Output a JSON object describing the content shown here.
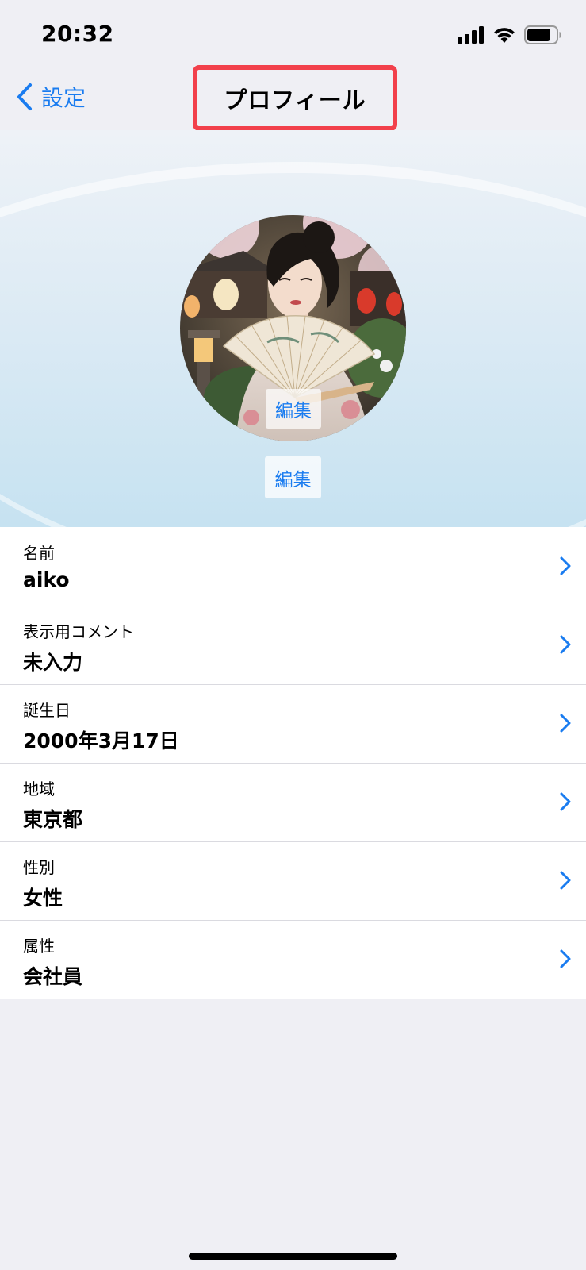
{
  "status_bar": {
    "time": "20:32"
  },
  "nav": {
    "back_label": "設定",
    "title": "プロフィール"
  },
  "hero": {
    "avatar_edit_label": "編集",
    "background_edit_label": "編集"
  },
  "profile_items": [
    {
      "label": "名前",
      "value": "aiko"
    },
    {
      "label": "表示用コメント",
      "value": "未入力"
    },
    {
      "label": "誕生日",
      "value": "2000年3月17日"
    },
    {
      "label": "地域",
      "value": "東京都"
    },
    {
      "label": "性別",
      "value": "女性"
    },
    {
      "label": "属性",
      "value": "会社員"
    }
  ],
  "colors": {
    "accent": "#1a7cf0",
    "highlight_border": "#f2404b",
    "background": "#efeff4"
  }
}
